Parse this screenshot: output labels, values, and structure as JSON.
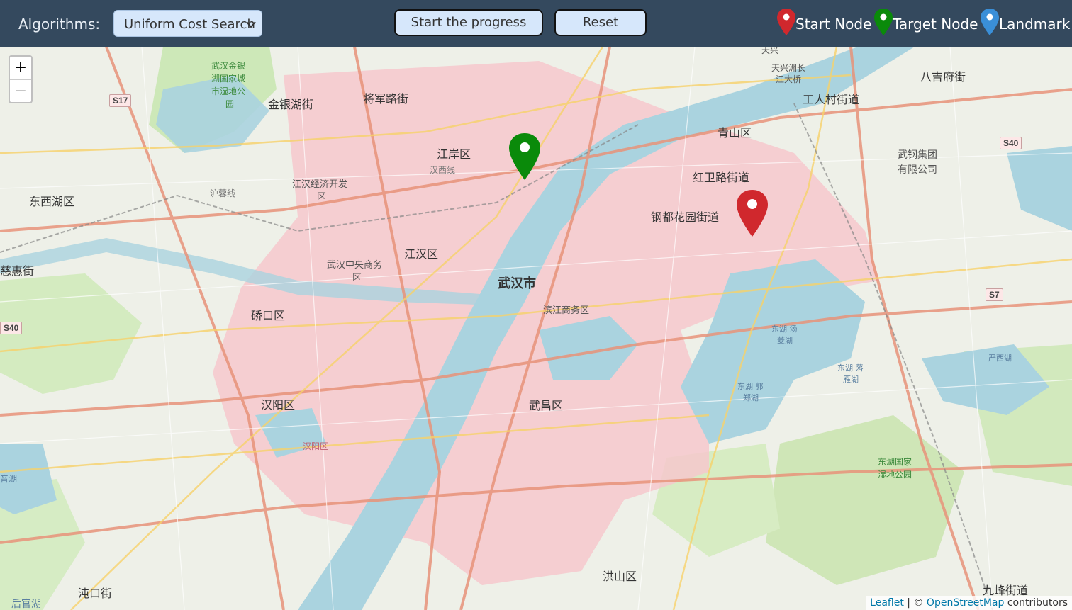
{
  "toolbar": {
    "algorithms_label": "Algorithms:",
    "algorithm_selected": "Uniform Cost Search",
    "start_button": "Start the progress",
    "reset_button": "Reset"
  },
  "legend": {
    "start_label": "Start Node",
    "target_label": "Target Node",
    "landmark_label": "Landmark"
  },
  "colors": {
    "toolbar_bg": "#34495e",
    "button_bg": "#d6e7fb",
    "start_marker": "#d0282d",
    "target_marker": "#0a8a0a",
    "landmark_marker": "#3a8fd8",
    "urban_area": "#f6c8cc",
    "river": "#aad3df"
  },
  "map": {
    "zoom_in": "+",
    "zoom_out": "−",
    "labels": {
      "jiangan": "江岸区",
      "jianghan": "江汉区",
      "wuhan": "武汉市",
      "qiaokou": "硚口区",
      "hanyang": "汉阳区",
      "wuchang": "武昌区",
      "qingshan": "青山区",
      "hongshan": "洪山区",
      "dongxihu": "东西湖区",
      "jinyinhu": "金银湖街",
      "jiangjunlu": "将军路街",
      "gongrencun": "工人村街道",
      "bajifu": "八吉府街",
      "hongweilu": "红卫路街道",
      "gangduhuayuan": "钢都花园街道",
      "wugang_1": "武钢集团",
      "wugang_2": "有限公司",
      "cihui": "慈惠街",
      "binjiang": "滨江商务区",
      "cbd_1": "武汉中央商务",
      "cbd_2": "区",
      "jhdev_1": "江汉经济开发",
      "jhdev_2": "区",
      "tianxingzhou": "天兴洲长",
      "jiangdaqiao": "江大桥",
      "tianxing": "天兴",
      "hanyang_small": "汉阳区",
      "jiufeng": "九峰街道",
      "zhuankou": "沌口街",
      "houguanhu": "后官湖",
      "wetland_1": "武汉金银",
      "wetland_2": "湖国家城",
      "wetland_3": "市湿地公",
      "wetland_4": "园",
      "donghu_wetland_1": "东湖国家",
      "donghu_wetland_2": "湿地公园",
      "hanxi": "汉西线",
      "hanxi2": "沪蓉线",
      "yinhu": "音湖",
      "donghu_1": "东湖 汤",
      "donghu_2": "菱湖",
      "donghu_3": "东湖 郭",
      "donghu_4": "郑湖",
      "donghu_5": "东湖 落",
      "donghu_6": "雁湖",
      "yanxi": "严西湖"
    },
    "shields": {
      "s17": "S17",
      "s40_left": "S40",
      "s40_right": "S40",
      "s7": "S7"
    }
  },
  "attribution": {
    "leaflet": "Leaflet",
    "sep": " | © ",
    "osm": "OpenStreetMap",
    "contrib": " contributors"
  }
}
